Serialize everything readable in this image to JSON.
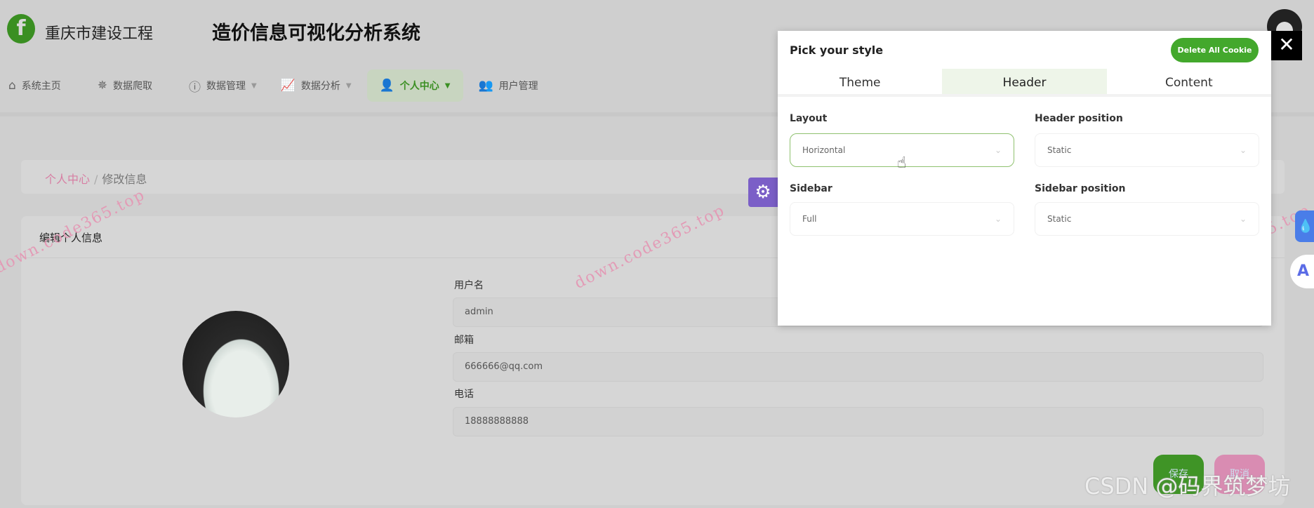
{
  "header": {
    "logo_letter": "f",
    "brand": "重庆市建设工程",
    "title": "造价信息可视化分析系统"
  },
  "nav": [
    {
      "label": "系统主页",
      "icon": "home-icon"
    },
    {
      "label": "数据爬取",
      "icon": "spider-icon"
    },
    {
      "label": "数据管理",
      "icon": "info-icon"
    },
    {
      "label": "数据分析",
      "icon": "chart-icon"
    },
    {
      "label": "个人中心",
      "icon": "user-icon"
    },
    {
      "label": "用户管理",
      "icon": "user-gear-icon"
    }
  ],
  "breadcrumb": {
    "parent": "个人中心",
    "separator": "/",
    "current": "修改信息"
  },
  "card": {
    "title": "编辑个人信息"
  },
  "form": {
    "username_label": "用户名",
    "username": "admin",
    "email_label": "邮箱",
    "email": "666666@qq.com",
    "phone_label": "电话",
    "phone": "18888888888",
    "save": "保存",
    "reset": "取消"
  },
  "style_modal": {
    "title": "Pick your style",
    "delete_button": "Delete All Cookie",
    "close": "✕",
    "tabs": [
      "Theme",
      "Header",
      "Content"
    ],
    "active_tab": "Header",
    "layout_label": "Layout",
    "layout_value": "Horizontal",
    "header_position_label": "Header position",
    "header_position_value": "Static",
    "sidebar_label": "Sidebar",
    "sidebar_value": "Full",
    "sidebar_position_label": "Sidebar position",
    "sidebar_position_value": "Static"
  },
  "watermark": "down.code365.top",
  "csdn": "CSDN @码界筑梦坊",
  "colors": {
    "accent": "#3a8f22",
    "pink": "#d77ea3",
    "purple": "#7b5fc7",
    "blue": "#4a7de8"
  }
}
